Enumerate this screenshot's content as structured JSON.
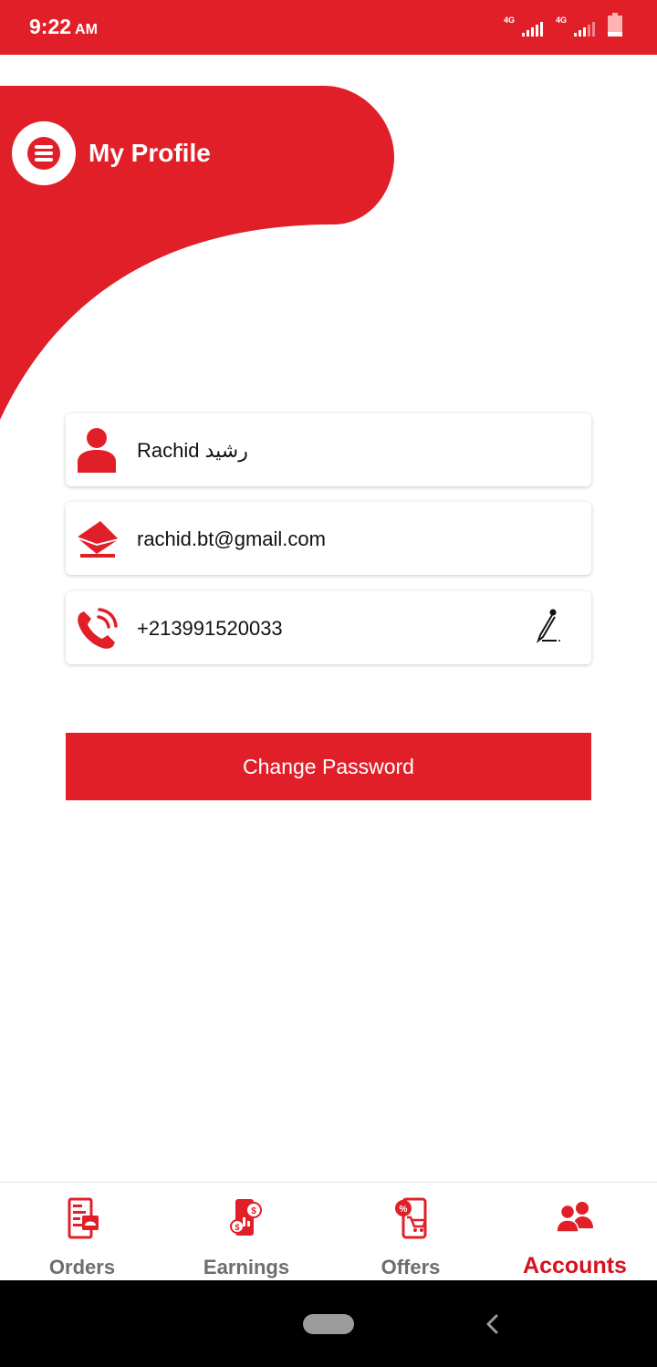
{
  "status_bar": {
    "time": "9:22",
    "ampm": "AM",
    "network_1": "4G",
    "network_2": "4G",
    "icons": [
      "signal-icon",
      "signal-icon",
      "battery-icon"
    ]
  },
  "header": {
    "title": "My Profile",
    "menu_icon": "hamburger-menu-icon"
  },
  "profile": {
    "name": "Rachid رشيد",
    "email": "rachid.bt@gmail.com",
    "phone": "+213991520033",
    "icons": {
      "name": "user-icon",
      "email": "mail-icon",
      "phone": "phone-icon",
      "edit": "pencil-edit-icon"
    }
  },
  "actions": {
    "change_password": "Change Password"
  },
  "bottom_nav": {
    "items": [
      {
        "label": "Orders",
        "icon": "orders-icon",
        "active": false
      },
      {
        "label": "Earnings",
        "icon": "earnings-icon",
        "active": false
      },
      {
        "label": "Offers",
        "icon": "offers-icon",
        "active": false
      },
      {
        "label": "Accounts",
        "icon": "accounts-icon",
        "active": true
      }
    ]
  },
  "colors": {
    "brand_red": "#e11f29",
    "active_label": "#d7111e",
    "inactive_label": "#6d6d6d"
  }
}
